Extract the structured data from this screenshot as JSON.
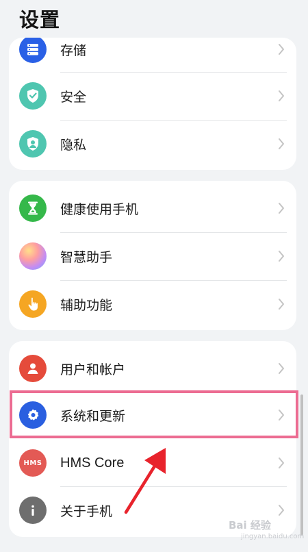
{
  "header": {
    "title": "设置"
  },
  "groups": [
    {
      "items": [
        {
          "label": "存储"
        },
        {
          "label": "安全"
        },
        {
          "label": "隐私"
        }
      ]
    },
    {
      "items": [
        {
          "label": "健康使用手机"
        },
        {
          "label": "智慧助手"
        },
        {
          "label": "辅助功能"
        }
      ]
    },
    {
      "items": [
        {
          "label": "用户和帐户"
        },
        {
          "label": "系统和更新"
        },
        {
          "label": "HMS Core"
        },
        {
          "label": "关于手机"
        }
      ]
    }
  ],
  "icons": {
    "storage": "storage-icon",
    "security": "shield-check-icon",
    "privacy": "privacy-shield-icon",
    "digital_balance": "hourglass-icon",
    "assistant": "assistant-orb-icon",
    "accessibility": "hand-pointer-icon",
    "users": "user-icon",
    "system": "gear-icon",
    "hms": "hms-logo-icon",
    "about": "info-icon"
  },
  "hms_badge": "HMS",
  "highlighted_item": "系统和更新",
  "watermark": {
    "line1": "Bai 经验",
    "line2": "jingyan.baidu.com"
  },
  "colors": {
    "background": "#f1f3f5",
    "storage": "#2a60e6",
    "security": "#4fc6b0",
    "privacy": "#4fc6b0",
    "digital_balance": "#35b84a",
    "accessibility": "#f5a623",
    "users": "#e54b3b",
    "system": "#2a5fe0",
    "hms": "#e35a55",
    "about": "#6e6e6e",
    "highlight": "#ec6c92",
    "annotation_arrow": "#e8232c"
  }
}
